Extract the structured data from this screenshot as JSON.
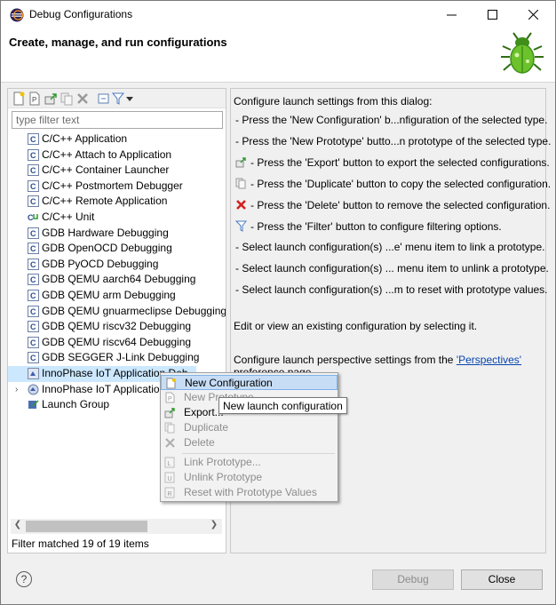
{
  "window": {
    "title": "Debug Configurations",
    "header_title": "Create, manage, and run configurations"
  },
  "left": {
    "filter_placeholder": "type filter text",
    "tree_items": [
      {
        "label": "C/C++ Application",
        "icon": "c-app-icon"
      },
      {
        "label": "C/C++ Attach to Application",
        "icon": "c-app-icon"
      },
      {
        "label": "C/C++ Container Launcher",
        "icon": "c-app-icon"
      },
      {
        "label": "C/C++ Postmortem Debugger",
        "icon": "c-app-icon"
      },
      {
        "label": "C/C++ Remote Application",
        "icon": "c-app-icon"
      },
      {
        "label": "C/C++ Unit",
        "icon": "cunit-icon"
      },
      {
        "label": "GDB Hardware Debugging",
        "icon": "c-app-icon"
      },
      {
        "label": "GDB OpenOCD Debugging",
        "icon": "c-app-icon"
      },
      {
        "label": "GDB PyOCD Debugging",
        "icon": "c-app-icon"
      },
      {
        "label": "GDB QEMU aarch64 Debugging",
        "icon": "c-app-icon"
      },
      {
        "label": "GDB QEMU arm Debugging",
        "icon": "c-app-icon"
      },
      {
        "label": "GDB QEMU gnuarmeclipse Debugging (",
        "icon": "c-app-icon"
      },
      {
        "label": "GDB QEMU riscv32 Debugging",
        "icon": "c-app-icon"
      },
      {
        "label": "GDB QEMU riscv64 Debugging",
        "icon": "c-app-icon"
      },
      {
        "label": "GDB SEGGER J-Link Debugging",
        "icon": "c-app-icon"
      },
      {
        "label": "InnoPhase IoT Application Deb",
        "icon": "innophase-icon"
      },
      {
        "label": "InnoPhase IoT Application",
        "icon": "innophase-icon"
      },
      {
        "label": "Launch Group",
        "icon": "launch-group-icon"
      }
    ],
    "status": "Filter matched 19 of 19 items"
  },
  "right": {
    "intro": "Configure launch settings from this dialog:",
    "lines": [
      {
        "text": "- Press the 'New Configuration' b...nfiguration of the selected type.",
        "icon": ""
      },
      {
        "text": "- Press the 'New Prototype' butto...n prototype of the selected type.",
        "icon": ""
      },
      {
        "text": "- Press the 'Export' button to export the selected configurations.",
        "icon": "export-icon"
      },
      {
        "text": "- Press the 'Duplicate' button to copy the selected configuration.",
        "icon": "duplicate-icon"
      },
      {
        "text": "- Press the 'Delete' button to remove the selected configuration.",
        "icon": "delete-icon"
      },
      {
        "text": "- Press the 'Filter' button to configure filtering options.",
        "icon": "filter-icon"
      },
      {
        "text": "- Select launch configuration(s) ...e' menu item to link a prototype.",
        "icon": ""
      },
      {
        "text": "- Select launch configuration(s) ... menu item to unlink a prototype.",
        "icon": ""
      },
      {
        "text": "- Select launch configuration(s) ...m to reset with prototype values.",
        "icon": ""
      }
    ],
    "edit_text": "Edit or view an existing configuration by selecting it.",
    "perspective_text": "Configure launch perspective settings from the ",
    "perspective_link": "'Perspectives'",
    "perspective_tail": "preference page."
  },
  "context_menu": {
    "items": [
      {
        "label": "New Configuration",
        "enabled": true,
        "highlighted": true
      },
      {
        "label": "New Prototype",
        "enabled": false
      },
      {
        "label": "Export...",
        "enabled": true
      },
      {
        "label": "Duplicate",
        "enabled": false
      },
      {
        "label": "Delete",
        "enabled": false
      },
      {
        "label": "Link Prototype...",
        "enabled": false
      },
      {
        "label": "Unlink Prototype",
        "enabled": false
      },
      {
        "label": "Reset with Prototype Values",
        "enabled": false
      }
    ]
  },
  "tooltip": "New launch configuration",
  "buttons": {
    "help": "?",
    "debug": "Debug",
    "close": "Close"
  },
  "colors": {
    "selection": "#cce8ff",
    "menu_highlight": "#c7ddf6",
    "link": "#0645ad",
    "delete_red": "#d32020"
  }
}
